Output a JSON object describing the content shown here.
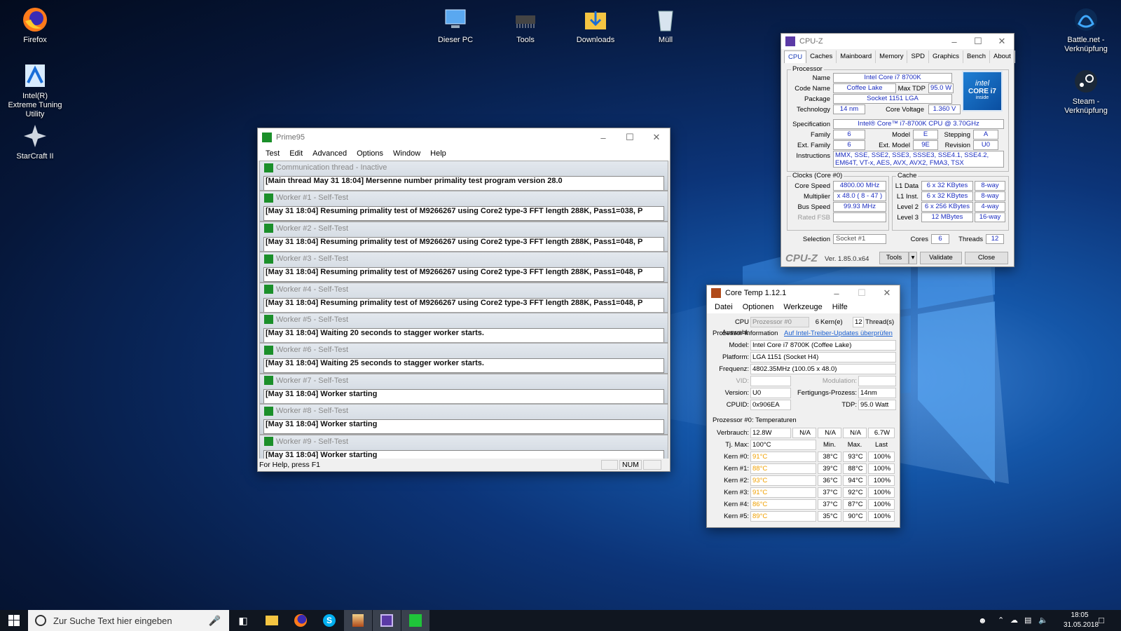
{
  "desktop": {
    "icons": [
      {
        "label": "Firefox"
      },
      {
        "label": "Intel(R) Extreme Tuning Utility"
      },
      {
        "label": "StarCraft II"
      },
      {
        "label": "Dieser PC"
      },
      {
        "label": "Tools"
      },
      {
        "label": "Downloads"
      },
      {
        "label": "Müll"
      },
      {
        "label": "Battle.net - Verknüpfung"
      },
      {
        "label": "Steam - Verknüpfung"
      }
    ]
  },
  "prime95": {
    "title": "Prime95",
    "menu": [
      "Test",
      "Edit",
      "Advanced",
      "Options",
      "Window",
      "Help"
    ],
    "workers": [
      {
        "title": "Communication thread - Inactive",
        "log": "[Main thread May 31 18:04] Mersenne number primality test program version 28.0"
      },
      {
        "title": "Worker #1 - Self-Test",
        "log": "[May 31 18:04] Resuming primality test of M9266267 using Core2 type-3 FFT length 288K, Pass1=038, P"
      },
      {
        "title": "Worker #2 - Self-Test",
        "log": "[May 31 18:04] Resuming primality test of M9266267 using Core2 type-3 FFT length 288K, Pass1=048, P"
      },
      {
        "title": "Worker #3 - Self-Test",
        "log": "[May 31 18:04] Resuming primality test of M9266267 using Core2 type-3 FFT length 288K, Pass1=048, P"
      },
      {
        "title": "Worker #4 - Self-Test",
        "log": "[May 31 18:04] Resuming primality test of M9266267 using Core2 type-3 FFT length 288K, Pass1=048, P"
      },
      {
        "title": "Worker #5 - Self-Test",
        "log": "[May 31 18:04] Waiting 20 seconds to stagger worker starts."
      },
      {
        "title": "Worker #6 - Self-Test",
        "log": "[May 31 18:04] Waiting 25 seconds to stagger worker starts."
      },
      {
        "title": "Worker #7 - Self-Test",
        "log": "[May 31 18:04] Worker starting"
      },
      {
        "title": "Worker #8 - Self-Test",
        "log": "[May 31 18:04] Worker starting"
      },
      {
        "title": "Worker #9 - Self-Test",
        "log": "[May 31 18:04] Worker starting"
      }
    ],
    "status_text": "For Help, press F1",
    "status_num": "NUM"
  },
  "cpuz": {
    "title": "CPU-Z",
    "tabs": [
      "CPU",
      "Caches",
      "Mainboard",
      "Memory",
      "SPD",
      "Graphics",
      "Bench",
      "About"
    ],
    "processor_group": "Processor",
    "name_label": "Name",
    "name": "Intel Core i7 8700K",
    "codename_label": "Code Name",
    "codename": "Coffee Lake",
    "maxtdp_label": "Max TDP",
    "maxtdp": "95.0 W",
    "package_label": "Package",
    "package": "Socket 1151 LGA",
    "technology_label": "Technology",
    "technology": "14 nm",
    "corevoltage_label": "Core Voltage",
    "corevoltage": "1.360 V",
    "spec_label": "Specification",
    "spec": "Intel® Core™ i7-8700K CPU @ 3.70GHz",
    "family_label": "Family",
    "family": "6",
    "model_label": "Model",
    "model": "E",
    "stepping_label": "Stepping",
    "stepping": "A",
    "extfamily_label": "Ext. Family",
    "extfamily": "6",
    "extmodel_label": "Ext. Model",
    "extmodel": "9E",
    "revision_label": "Revision",
    "revision": "U0",
    "instructions_label": "Instructions",
    "instructions": "MMX, SSE, SSE2, SSE3, SSSE3, SSE4.1, SSE4.2, EM64T, VT-x, AES, AVX, AVX2, FMA3, TSX",
    "clocks_group": "Clocks (Core #0)",
    "corespeed_label": "Core Speed",
    "corespeed": "4800.00 MHz",
    "multiplier_label": "Multiplier",
    "multiplier": "x 48.0 ( 8 - 47 )",
    "busspeed_label": "Bus Speed",
    "busspeed": "99.93 MHz",
    "ratedfsb_label": "Rated FSB",
    "cache_group": "Cache",
    "l1d_label": "L1 Data",
    "l1d": "6 x 32 KBytes",
    "l1d_way": "8-way",
    "l1i_label": "L1 Inst.",
    "l1i": "6 x 32 KBytes",
    "l1i_way": "8-way",
    "l2_label": "Level 2",
    "l2": "6 x 256 KBytes",
    "l2_way": "4-way",
    "l3_label": "Level 3",
    "l3": "12 MBytes",
    "l3_way": "16-way",
    "selection_label": "Selection",
    "selection": "Socket #1",
    "cores_label": "Cores",
    "cores": "6",
    "threads_label": "Threads",
    "threads": "12",
    "logo": "CPU-Z",
    "version": "Ver. 1.85.0.x64",
    "tools_btn": "Tools",
    "validate_btn": "Validate",
    "close_btn": "Close",
    "intel_badge": {
      "line1": "intel",
      "line2": "CORE i7",
      "line3": "inside"
    }
  },
  "coretemp": {
    "title": "Core Temp 1.12.1",
    "menu": [
      "Datei",
      "Optionen",
      "Werkzeuge",
      "Hilfe"
    ],
    "cpu_select_label": "CPU Auswahl:",
    "cpu_select": "Prozessor #0",
    "cores_value": "6",
    "cores_label": "Kern(e)",
    "threads_value": "12",
    "threads_label": "Thread(s)",
    "info_header": "Prozessor-Information",
    "update_link": "Auf Intel-Treiber-Updates überprüfen",
    "model_label": "Model:",
    "model": "Intel Core i7 8700K (Coffee Lake)",
    "platform_label": "Platform:",
    "platform": "LGA 1151 (Socket H4)",
    "freq_label": "Frequenz:",
    "freq": "4802.35MHz (100.05 x 48.0)",
    "vid_label": "VID:",
    "modulation_label": "Modulation:",
    "version_label": "Version:",
    "version": "U0",
    "process_label": "Fertigungs-Prozess:",
    "process": "14nm",
    "cpuid_label": "CPUID:",
    "cpuid": "0x906EA",
    "tdp_label": "TDP:",
    "tdp": "95.0 Watt",
    "temps_header": "Prozessor #0: Temperaturen",
    "power_label": "Verbrauch:",
    "power": "12.8W",
    "power2": "N/A",
    "power3": "N/A",
    "power4": "N/A",
    "power5": "6.7W",
    "tjmax_label": "Tj. Max:",
    "tjmax": "100°C",
    "col_min": "Min.",
    "col_max": "Max.",
    "col_last": "Last",
    "cores": [
      {
        "label": "Kern #0:",
        "temp": "91°C",
        "min": "38°C",
        "max": "93°C",
        "load": "100%"
      },
      {
        "label": "Kern #1:",
        "temp": "88°C",
        "min": "39°C",
        "max": "88°C",
        "load": "100%"
      },
      {
        "label": "Kern #2:",
        "temp": "93°C",
        "min": "36°C",
        "max": "94°C",
        "load": "100%"
      },
      {
        "label": "Kern #3:",
        "temp": "91°C",
        "min": "37°C",
        "max": "92°C",
        "load": "100%"
      },
      {
        "label": "Kern #4:",
        "temp": "86°C",
        "min": "37°C",
        "max": "87°C",
        "load": "100%"
      },
      {
        "label": "Kern #5:",
        "temp": "89°C",
        "min": "35°C",
        "max": "90°C",
        "load": "100%"
      }
    ]
  },
  "taskbar": {
    "search_placeholder": "Zur Suche Text hier eingeben",
    "time": "18:05",
    "date": "31.05.2018"
  }
}
